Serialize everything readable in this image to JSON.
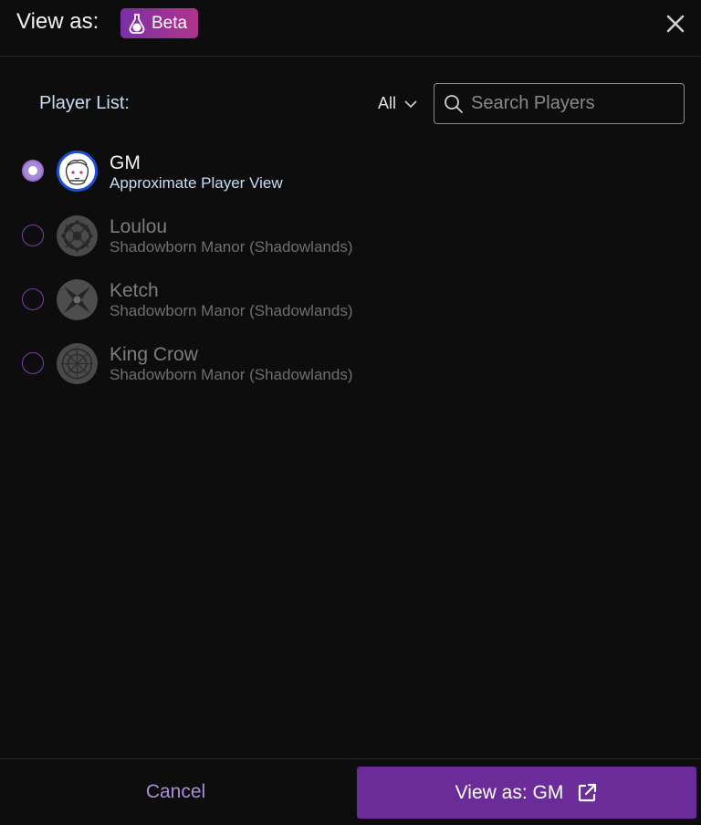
{
  "header": {
    "title": "View as:",
    "badge": "Beta"
  },
  "player_list": {
    "label": "Player List:",
    "filter": "All",
    "search_placeholder": "Search Players",
    "players": [
      {
        "name": "GM",
        "subtitle": "Approximate Player View",
        "selected": true
      },
      {
        "name": "Loulou",
        "subtitle": "Shadowborn Manor (Shadowlands)",
        "selected": false
      },
      {
        "name": "Ketch",
        "subtitle": "Shadowborn Manor (Shadowlands)",
        "selected": false
      },
      {
        "name": "King Crow",
        "subtitle": "Shadowborn Manor (Shadowlands)",
        "selected": false
      }
    ]
  },
  "footer": {
    "cancel": "Cancel",
    "confirm": "View as: GM"
  },
  "colors": {
    "accent": "#6b2c9a",
    "background": "#0d0d0e"
  }
}
